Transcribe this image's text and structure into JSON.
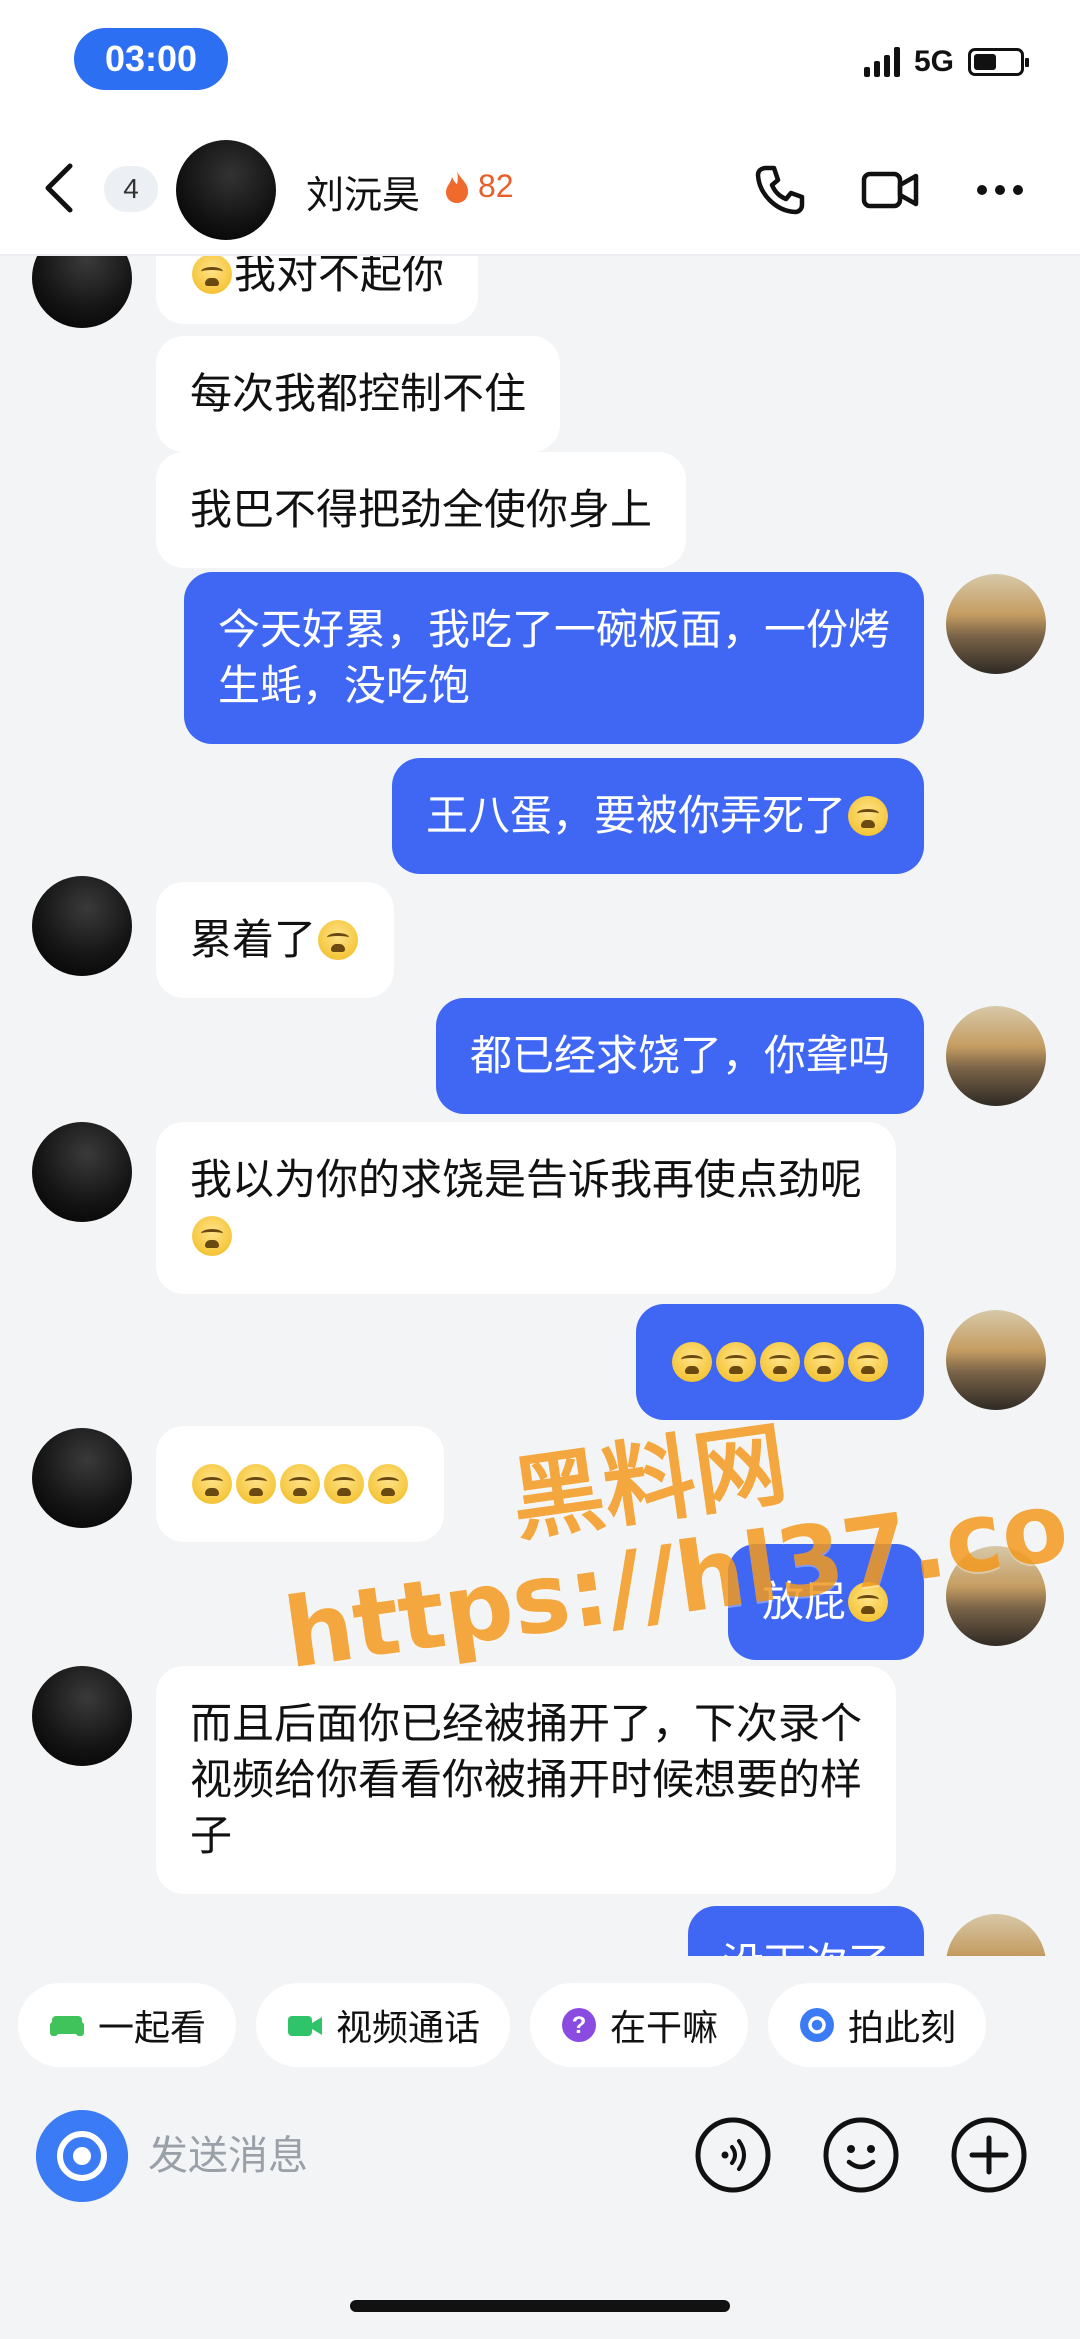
{
  "status_bar": {
    "time": "03:00",
    "network": "5G"
  },
  "header": {
    "unread_count": "4",
    "contact_name": "刘沅昊",
    "spark_count": "82"
  },
  "messages": [
    {
      "side": "in",
      "text": "我对不起你",
      "emoji_prefix": 1,
      "partial": true
    },
    {
      "side": "in",
      "text": "每次我都控制不住"
    },
    {
      "side": "in",
      "text": "我巴不得把劲全使你身上"
    },
    {
      "side": "out",
      "text": "今天好累，我吃了一碗板面，一份烤生蚝，没吃饱"
    },
    {
      "side": "out",
      "text": "王八蛋，要被你弄死了",
      "emoji_suffix": 1
    },
    {
      "side": "in",
      "text": "累着了",
      "emoji_suffix": 1
    },
    {
      "side": "out",
      "text": "都已经求饶了，你聋吗"
    },
    {
      "side": "in",
      "text": "我以为你的求饶是告诉我再使点劲呢",
      "emoji_suffix": 1
    },
    {
      "side": "out",
      "text": "",
      "emoji_suffix": 5
    },
    {
      "side": "in",
      "text": "",
      "emoji_suffix": 5
    },
    {
      "side": "out",
      "text": "放屁",
      "emoji_suffix": 1
    },
    {
      "side": "in",
      "text": "而且后面你已经被捅开了，下次录个视频给你看看你被捅开时候想要的样子"
    },
    {
      "side": "out",
      "text": "没下次了",
      "partial": true
    }
  ],
  "watermark": {
    "line1": "黑料网",
    "line2": "https://hl37.co"
  },
  "quick_actions": [
    {
      "label": "一起看",
      "icon": "sofa-icon",
      "color": "#3fc35a"
    },
    {
      "label": "视频通话",
      "icon": "video-icon",
      "color": "#2fc46a"
    },
    {
      "label": "在干嘛",
      "icon": "question-icon",
      "color": "#8a4be0"
    },
    {
      "label": "拍此刻",
      "icon": "camera-icon",
      "color": "#3b7cf6"
    }
  ],
  "composer": {
    "placeholder": "发送消息"
  },
  "colors": {
    "accent": "#3f67f4",
    "badge": "#2d6ff3",
    "watermark": "#f39a1f"
  }
}
